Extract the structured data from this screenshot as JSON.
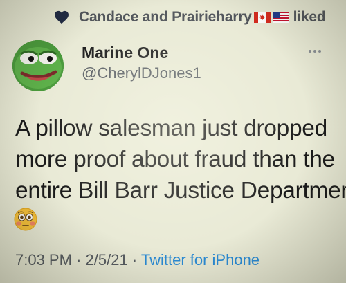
{
  "liked": {
    "names": "Candace and Prairieharry",
    "suffix": "liked",
    "icon": "heart-icon",
    "flags": [
      "canada-flag-icon",
      "us-flag-icon"
    ],
    "heart_color": "#1f2a44"
  },
  "author": {
    "name": "Marine One",
    "handle": "@CherylDJones1",
    "avatar": "pepe-frog-avatar"
  },
  "tweet": {
    "lines": [
      "A pillow salesman just dropped",
      "more proof about fraud than the",
      "entire Bill Barr Justice Department"
    ],
    "emoji": "flushed-face-emoji"
  },
  "meta": {
    "time": "7:03 PM",
    "date": "2/5/21",
    "separator": "·",
    "source": "Twitter for iPhone",
    "source_color": "#2a8bd6"
  }
}
